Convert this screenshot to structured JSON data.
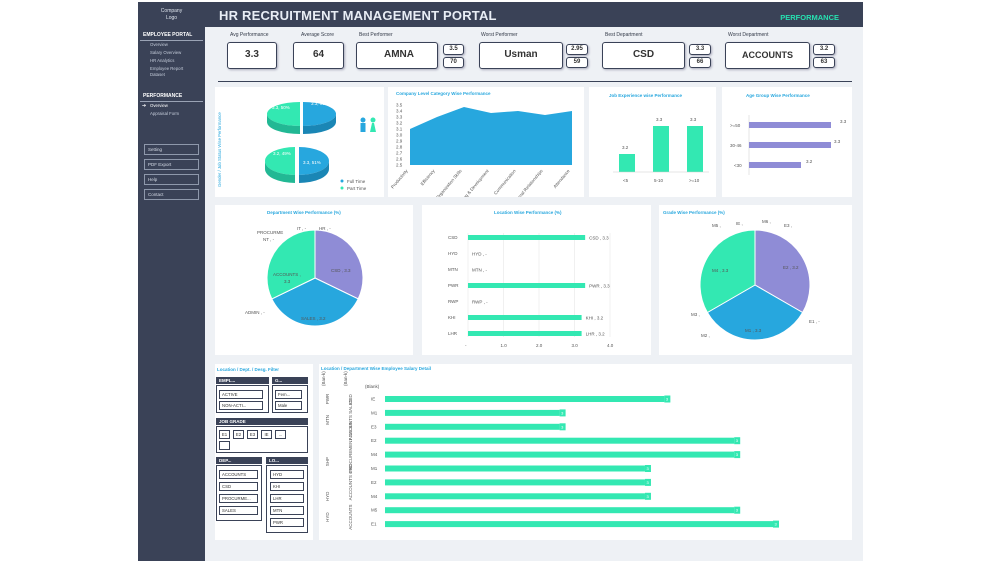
{
  "sidebar": {
    "logo_line1": "Company",
    "logo_line2": "Logo",
    "employee_portal": "EMPLOYEE PORTAL",
    "portal_items": [
      "Overview",
      "Salary Overview",
      "HR Analytics",
      "Employee Report",
      "Dataset"
    ],
    "performance": "PERFORMANCE",
    "performance_items": [
      "Overview",
      "Appraisal Form"
    ],
    "buttons": [
      "Setting",
      "PDF Export",
      "Help",
      "Contact"
    ]
  },
  "header": {
    "title": "HR RECRUITMENT MANAGEMENT PORTAL",
    "tag": "PERFORMANCE"
  },
  "kpis": {
    "avg_performance": {
      "label": "Avg Performance",
      "value": "3.3"
    },
    "average_score": {
      "label": "Average Score",
      "value": "64"
    },
    "best_performer": {
      "label": "Best Performer",
      "name": "AMNA",
      "score": "3.5",
      "sub": "70"
    },
    "worst_performer": {
      "label": "Worst Performer",
      "name": "Usman",
      "score": "2.95",
      "sub": "59"
    },
    "best_department": {
      "label": "Best Department",
      "name": "CSD",
      "score": "3.3",
      "sub": "66"
    },
    "worst_department": {
      "label": "Worst Department",
      "name": "ACCOUNTS",
      "score": "3.2",
      "sub": "63"
    }
  },
  "gender_panel": {
    "side_label": "Gender / Job Status Wise Performance",
    "pie1": {
      "labels": [
        "3.3, 50%",
        "3.3, 50%"
      ]
    },
    "pie2": {
      "labels": [
        "3.2, 49%",
        "3.3, 51%"
      ]
    },
    "legend": [
      "Full Time",
      "Part Time"
    ],
    "colors": {
      "teal": "#33e8b2",
      "blue": "#27a7de"
    }
  },
  "company_panel": {
    "title": "Company Level Category Wise Performance",
    "y_ticks": [
      "3.5",
      "3.4",
      "3.3",
      "3.2",
      "3.1",
      "3.0",
      "2.9",
      "2.8",
      "2.7",
      "2.6",
      "2.5"
    ],
    "categories": [
      "Productivity",
      "Efficiency",
      "Organization Skills",
      "Learning & Development",
      "Communication",
      "Internal Relationships",
      "Attendance"
    ]
  },
  "experience_panel": {
    "title": "Job Experience wise Performance",
    "categories": [
      "<5",
      "5-10",
      ">=10"
    ],
    "labels": [
      "3.2",
      "3.3",
      "3.3"
    ]
  },
  "age_panel": {
    "title": "Age Group Wise Performance",
    "categories": [
      ">=50",
      "30-46",
      "<30"
    ],
    "labels": [
      "3.3",
      "3.3",
      "3.2"
    ]
  },
  "department_panel": {
    "title": "Department Wise Performance (%)",
    "labels": [
      "IT , -",
      "HR , -",
      "PROCURME",
      "NT , -",
      "CSD , 3.3",
      "ACCOUNTS ,",
      "3.3",
      "SALES , 3.2",
      "ADMIN , -"
    ]
  },
  "location_panel": {
    "title": "Location Wise Performance (%)",
    "categories": [
      "CSD",
      "HYD",
      "MTN",
      "PWR",
      "RWP",
      "KHI",
      "LHR"
    ],
    "labels": [
      "CSD , 3.3",
      "HYD , -",
      "MTN , -",
      "PWR , 3.3",
      "RWP , -",
      "KHI , 3.2",
      "LHR , 3.2"
    ],
    "x_ticks": [
      "-",
      "1.0",
      "2.0",
      "3.0",
      "4.0"
    ]
  },
  "grade_panel": {
    "title": "Grade Wise Performance (%)",
    "labels": [
      "M5 ,",
      "IE ,",
      "M6 ,",
      "E3 ,",
      "M4 , 3.3",
      "E2 , 3.2",
      "M3 ,",
      "E1 , -",
      "M2 ,",
      "M1 , 3.3"
    ]
  },
  "filters": {
    "title": "Location / Dept. / Desg. Filter",
    "empl": "EMPL...",
    "status_items": [
      "ACTIVE",
      "NON-ACTI..."
    ],
    "g": "G...",
    "gender_items": [
      "Fem...",
      "Male"
    ],
    "job_grade": "JOB GRADE",
    "grade_items": [
      "E1",
      "E2",
      "E3",
      "IE",
      "..."
    ],
    "dep": "DEP...",
    "dep_items": [
      "ACCOUNTS",
      "CSD",
      "PROCURME...",
      "SALES"
    ],
    "lo": "LO...",
    "lo_items": [
      "HYD",
      "KHI",
      "LHR",
      "MTN",
      "PWR"
    ]
  },
  "salary_panel": {
    "title": "Location / Department Wise Employee Salary Detail",
    "head": [
      "(Ban-k)",
      "(Ban-k)",
      "(Blank)"
    ],
    "locations": [
      "PWR",
      "MTN",
      "SHP",
      "HYD",
      "HYD"
    ],
    "departments": [
      "CSD",
      "ACCOUNTS SALES",
      "PROCUREMENT SALES",
      "ACCOUNTS CSD",
      "ACCOUNTS"
    ],
    "rows": [
      "IE",
      "M1",
      "E3",
      "E2",
      "M4",
      "M1",
      "E2",
      "M4",
      "M5",
      "E1"
    ],
    "values": [
      3,
      3,
      3,
      3,
      3,
      3,
      3,
      3,
      3,
      3
    ],
    "scale": [
      0.72,
      0.45,
      0.45,
      0.9,
      0.9,
      0.67,
      0.67,
      0.67,
      0.9,
      1.0
    ]
  }
}
